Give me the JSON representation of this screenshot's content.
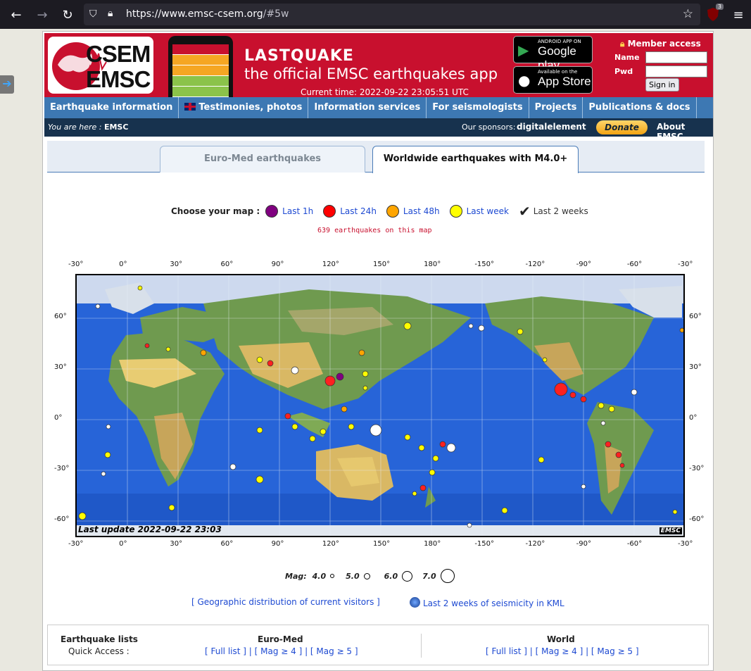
{
  "browser": {
    "url_host": "https://www.emsc-csem.org",
    "url_path": "/#5w",
    "ext_badge": "3"
  },
  "banner": {
    "logo_top": "CSEM",
    "logo_bottom": "EMSC",
    "app_title": "LASTQUAKE",
    "app_subtitle": "the official EMSC earthquakes app",
    "current_time": "Current time: 2022-09-22 23:05:51 UTC",
    "google_small": "ANDROID APP ON",
    "google_big": "Google play",
    "apple_small": "Available on the",
    "apple_big": "App Store",
    "member_access": "Member access",
    "name_label": "Name",
    "pwd_label": "Pwd",
    "signin": "Sign in"
  },
  "menu": [
    "Earthquake information",
    "Testimonies, photos",
    "Information services",
    "For seismologists",
    "Projects",
    "Publications & docs"
  ],
  "crumb": {
    "you_are_here": "You are here :",
    "location": "EMSC",
    "sponsors": "Our sponsors:",
    "sponsor_name": "digitalelement",
    "donate": "Donate",
    "about": "About EMSC"
  },
  "tabs": {
    "euromed": "Euro-Med earthquakes",
    "world": "Worldwide earthquakes with M4.0+"
  },
  "chooser": {
    "label": "Choose your map :",
    "options": [
      "Last 1h",
      "Last 24h",
      "Last 48h",
      "Last week",
      "Last 2 weeks"
    ],
    "colors": [
      "#800080",
      "#ff0000",
      "#ffa500",
      "#ffff00",
      "#000000"
    ],
    "count": "639 earthquakes on this map"
  },
  "map": {
    "x_ticks": [
      "-30°",
      "0°",
      "30°",
      "60°",
      "90°",
      "120°",
      "150°",
      "180°",
      "-150°",
      "-120°",
      "-90°",
      "-60°",
      "-30°"
    ],
    "y_ticks": [
      "60°",
      "30°",
      "0°",
      "-30°",
      "-60°"
    ],
    "last_update": "Last update 2022-09-22 23:03",
    "watermark": "EMSC"
  },
  "mag_legend": {
    "label": "Mag:",
    "values": [
      "4.0",
      "5.0",
      "6.0",
      "7.0"
    ]
  },
  "links": {
    "visitors": "[ Geographic distribution of current visitors ]",
    "kml": "Last 2 weeks of seismicity in KML"
  },
  "lists": {
    "title": "Earthquake lists",
    "quick": "Quick Access :",
    "euromed": "Euro-Med",
    "world": "World",
    "euromed_links": "[ Full list ] | [ Mag ≥ 4 ] | [ Mag ≥ 5 ]",
    "world_links": "[ Full list ] | [ Mag ≥ 4 ] | [ Mag ≥ 5 ]"
  }
}
